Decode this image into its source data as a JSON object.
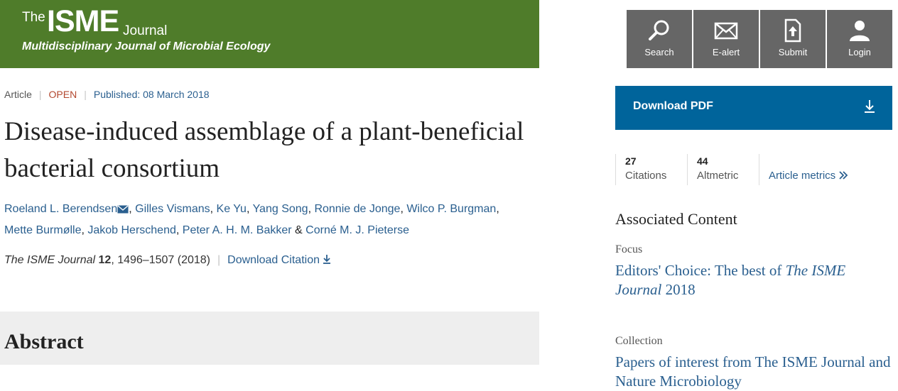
{
  "header": {
    "logo_the": "The",
    "logo_isme": "ISME",
    "logo_journal": "Journal",
    "logo_subtitle": "Multidisciplinary Journal of Microbial Ecology",
    "brand_color": "#4f7c2a"
  },
  "tools": [
    {
      "label": "Search",
      "icon": "search-icon"
    },
    {
      "label": "E-alert",
      "icon": "envelope-icon"
    },
    {
      "label": "Submit",
      "icon": "upload-document-icon"
    },
    {
      "label": "Login",
      "icon": "user-icon"
    }
  ],
  "article": {
    "type": "Article",
    "access": "OPEN",
    "published": "Published: 08 March 2018",
    "title": "Disease-induced assemblage of a plant-beneficial bacterial consortium",
    "authors": [
      "Roeland L. Berendsen",
      "Gilles Vismans",
      "Ke Yu",
      "Yang Song",
      "Ronnie de Jonge",
      "Wilco P. Burgman",
      "Mette Burmølle",
      "Jakob Herschend",
      "Peter A. H. M. Bakker",
      "Corné M. J. Pieterse"
    ],
    "author_sep": ", ",
    "author_last_sep": " & ",
    "journal": "The ISME Journal",
    "volume": "12",
    "pages_year": ", 1496–1507 (2018)",
    "download_citation": "Download Citation",
    "abstract_heading": "Abstract"
  },
  "sidebar": {
    "download_pdf": "Download PDF",
    "download_color": "#00649b",
    "citations_count": "27",
    "citations_label": "Citations",
    "altmetric_count": "44",
    "altmetric_label": "Altmetric",
    "metrics_link": "Article metrics",
    "associated_heading": "Associated Content",
    "focus_type": "Focus",
    "focus_link_pre": "Editors' Choice: The best of ",
    "focus_link_italic": "The ISME Journal",
    "focus_link_post": " 2018",
    "collection_type": "Collection",
    "collection_link": "Papers of interest from The ISME Journal and Nature Microbiology"
  }
}
